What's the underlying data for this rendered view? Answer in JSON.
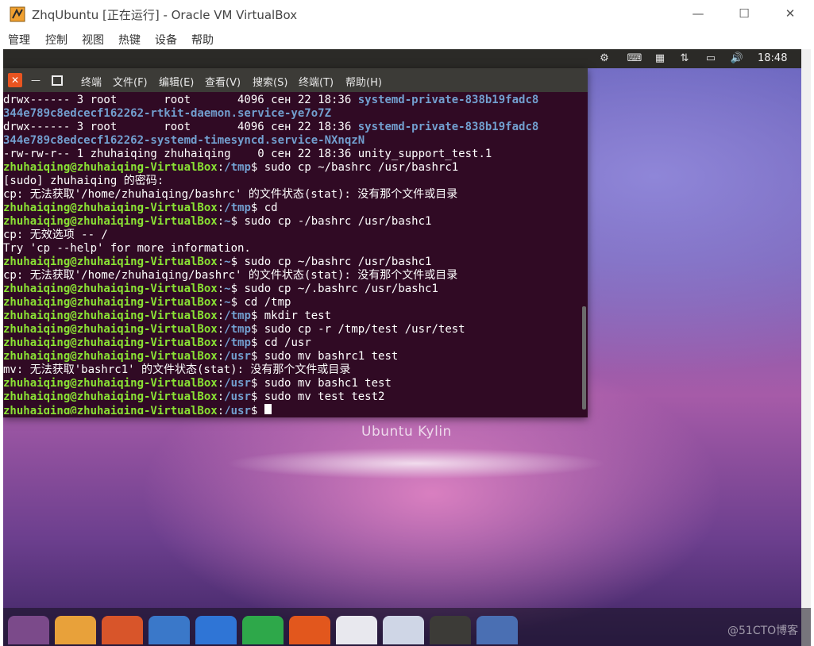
{
  "window": {
    "title": "ZhqUbuntu [正在运行] - Oracle VM VirtualBox",
    "icon": "virtualbox-icon",
    "controls": {
      "minimize": "—",
      "maximize": "☐",
      "close": "✕"
    }
  },
  "menubar": {
    "items": [
      "管理",
      "控制",
      "视图",
      "热键",
      "设备",
      "帮助"
    ]
  },
  "guest": {
    "panel": {
      "clock": "18:48",
      "tray_icons": [
        "settings-gear-icon",
        "keyboard-icon",
        "calendar-icon",
        "network-updown-icon",
        "battery-icon",
        "volume-icon"
      ]
    },
    "brand_text": "Ubuntu Kylin",
    "dock_watermark": "@51CTO博客"
  },
  "terminal": {
    "menu": [
      "终端",
      "文件(F)",
      "编辑(E)",
      "查看(V)",
      "搜索(S)",
      "终端(T)",
      "帮助(H)"
    ],
    "prompt_user": "zhuhaiqing@zhuhaiqing-VirtualBox",
    "lines": [
      {
        "type": "ls",
        "text": "drwx------ 3 root       root       4096 сен 22 18:36 ",
        "dir": "systemd-private-838b19fadc8"
      },
      {
        "type": "dirtext",
        "dir": "344e789c8edcecf162262-rtkit-daemon.service-ye7o7Z"
      },
      {
        "type": "ls",
        "text": "drwx------ 3 root       root       4096 сен 22 18:36 ",
        "dir": "systemd-private-838b19fadc8"
      },
      {
        "type": "dirtext",
        "dir": "344e789c8edcecf162262-systemd-timesyncd.service-NXnqzN"
      },
      {
        "type": "plain",
        "text": "-rw-rw-r-- 1 zhuhaiqing zhuhaiqing    0 сен 22 18:36 unity_support_test.1"
      },
      {
        "type": "prompt",
        "path": "/tmp",
        "cmd": " sudo cp ~/bashrc /usr/bashrc1"
      },
      {
        "type": "plain",
        "text": "[sudo] zhuhaiqing 的密码:"
      },
      {
        "type": "plain",
        "text": "cp: 无法获取'/home/zhuhaiqing/bashrc' 的文件状态(stat): 没有那个文件或目录"
      },
      {
        "type": "prompt",
        "path": "/tmp",
        "cmd": " cd"
      },
      {
        "type": "prompt",
        "path": "~",
        "cmd": " sudo cp -/bashrc /usr/bashc1"
      },
      {
        "type": "plain",
        "text": "cp: 无效选项 -- /"
      },
      {
        "type": "plain",
        "text": "Try 'cp --help' for more information."
      },
      {
        "type": "prompt",
        "path": "~",
        "cmd": " sudo cp ~/bashrc /usr/bashc1"
      },
      {
        "type": "plain",
        "text": "cp: 无法获取'/home/zhuhaiqing/bashrc' 的文件状态(stat): 没有那个文件或目录"
      },
      {
        "type": "prompt",
        "path": "~",
        "cmd": " sudo cp ~/.bashrc /usr/bashc1"
      },
      {
        "type": "prompt",
        "path": "~",
        "cmd": " cd /tmp"
      },
      {
        "type": "prompt",
        "path": "/tmp",
        "cmd": " mkdir test"
      },
      {
        "type": "prompt",
        "path": "/tmp",
        "cmd": " sudo cp -r /tmp/test /usr/test"
      },
      {
        "type": "prompt",
        "path": "/tmp",
        "cmd": " cd /usr"
      },
      {
        "type": "prompt",
        "path": "/usr",
        "cmd": " sudo mv bashrc1 test"
      },
      {
        "type": "plain",
        "text": "mv: 无法获取'bashrc1' 的文件状态(stat): 没有那个文件或目录"
      },
      {
        "type": "prompt",
        "path": "/usr",
        "cmd": " sudo mv bashc1 test"
      },
      {
        "type": "prompt",
        "path": "/usr",
        "cmd": " sudo mv test test2"
      },
      {
        "type": "prompt",
        "path": "/usr",
        "cmd": " ",
        "cursor": true
      }
    ]
  },
  "dock": {
    "items": [
      {
        "name": "dash-home-icon",
        "color": "#7b4a8a"
      },
      {
        "name": "files-folder-icon",
        "color": "#e8a13a"
      },
      {
        "name": "firefox-icon",
        "color": "#d8552a"
      },
      {
        "name": "search-settings-icon",
        "color": "#3a78c9"
      },
      {
        "name": "wps-writer-icon",
        "color": "#2f75d6"
      },
      {
        "name": "wps-spreadsheet-icon",
        "color": "#2ea84a"
      },
      {
        "name": "wps-presentation-icon",
        "color": "#e2571d"
      },
      {
        "name": "software-center-icon",
        "color": "#e8e8ee"
      },
      {
        "name": "system-monitor-icon",
        "color": "#cfd6e6"
      },
      {
        "name": "terminal-icon",
        "color": "#3c3b37"
      },
      {
        "name": "workspaces-icon",
        "color": "#4a6fb3"
      }
    ]
  }
}
